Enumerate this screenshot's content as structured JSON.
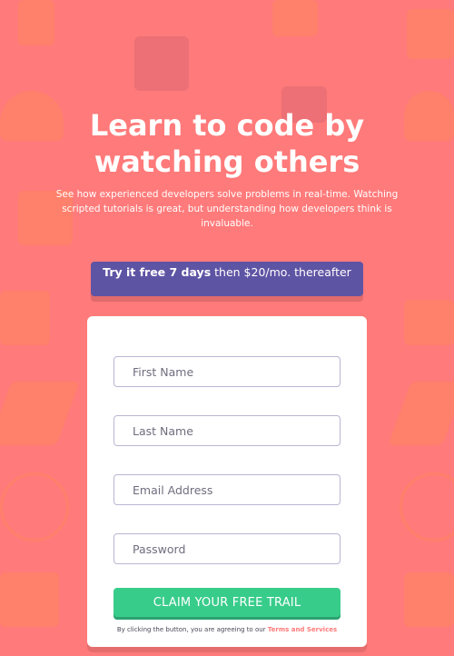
{
  "hero": {
    "title_line1": "Learn to code by",
    "title_line2": "watching others",
    "description": "See how experienced developers solve problems in real-time. Watching scripted tutorials is great, but understanding how developers think is invaluable."
  },
  "offer": {
    "bold_text": "Try it free 7 days",
    "rest_text": " then $20/mo. thereafter"
  },
  "form": {
    "first_name_placeholder": "First Name",
    "last_name_placeholder": "Last Name",
    "email_placeholder": "Email Address",
    "password_placeholder": "Password",
    "submit_label": "CLAIM YOUR FREE TRAIL",
    "terms_prefix": "By clicking the button, you are agreeing to our ",
    "terms_link": "Terms and Services"
  },
  "colors": {
    "background": "#ff7a7a",
    "banner": "#5e54a4",
    "button": "#38cc8b",
    "card": "#ffffff",
    "link": "#ff7a7a"
  },
  "icons": [
    "headset-icon",
    "bar-chart-icon",
    "rocket-icon",
    "globe-icon",
    "browser-window-icon",
    "briefcase-icon",
    "calendar-icon",
    "thumbs-up-icon"
  ]
}
